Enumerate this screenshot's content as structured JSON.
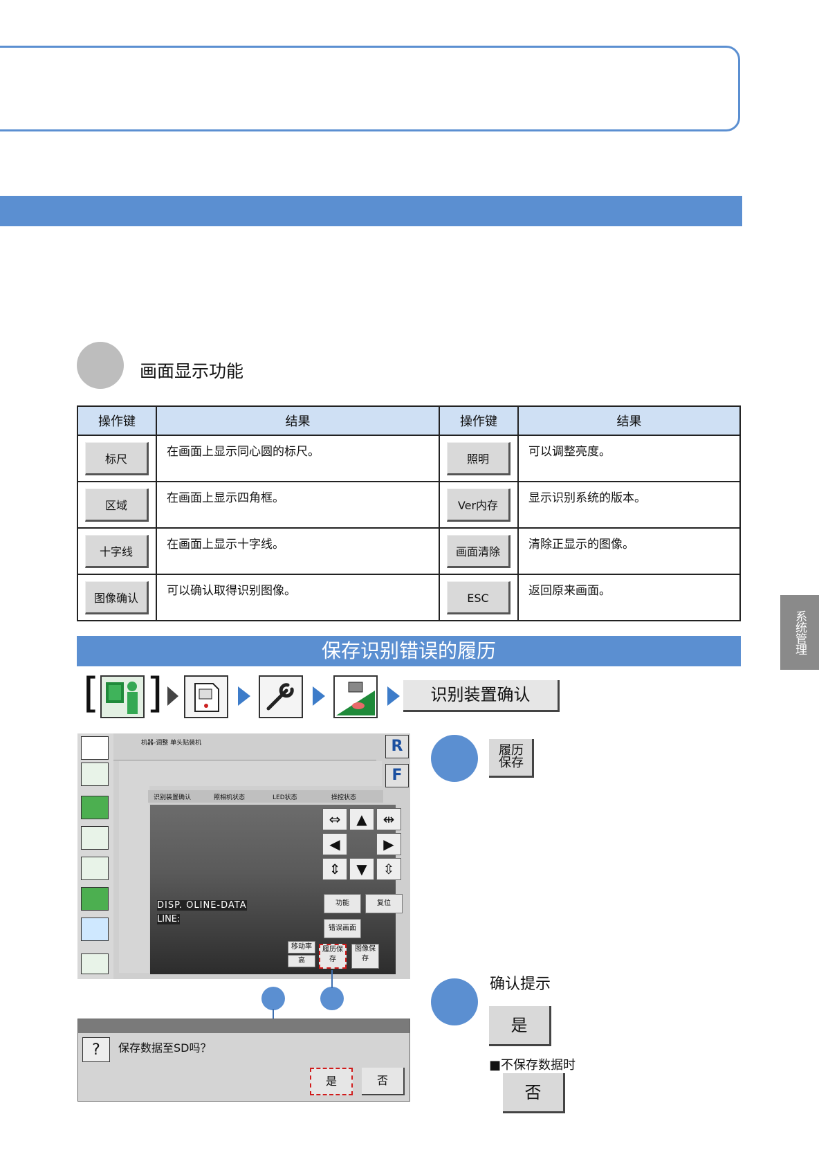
{
  "section": {
    "title": "画面显示功能"
  },
  "table": {
    "headers": [
      "操作键",
      "结果",
      "操作键",
      "结果"
    ],
    "rows": [
      {
        "key1": "标尺",
        "res1": "在画面上显示同心圆的标尺。",
        "key2": "照明",
        "res2": "可以调整亮度。"
      },
      {
        "key1": "区域",
        "res1": "在画面上显示四角框。",
        "key2": "Ver内存",
        "res2": "显示识别系统的版本。"
      },
      {
        "key1": "十字线",
        "res1": "在画面上显示十字线。",
        "key2": "画面清除",
        "res2": "清除正显示的图像。"
      },
      {
        "key1": "图像确认",
        "res1": "可以确认取得识别图像。",
        "key2": "ESC",
        "res2": "返回原来画面。"
      }
    ]
  },
  "side_tab": "系统管理",
  "save_section": {
    "title": "保存识别错误的履历",
    "nav_label": "识别装置确认",
    "history_button": "履历保存",
    "confirm_label": "确认提示",
    "yes_label": "是",
    "no_save_note": "■不保存数据时",
    "no_label": "否"
  },
  "screen": {
    "tabs": [
      "识别装置确认",
      "照相机状态",
      "LED状态",
      "操控状态"
    ],
    "overlay_text": "DISP. OLINE-DATA",
    "line_label": "LINE:",
    "buttons": [
      "功能",
      "复位",
      "错误画面",
      "移动率",
      "高",
      "履历保存",
      "图像保存"
    ],
    "r_key": "R",
    "f_key": "F",
    "machine_label": "机器-调整 单头贴装机"
  },
  "dialog": {
    "message": "保存数据至SD吗？",
    "yes": "是",
    "no": "否"
  },
  "colors": {
    "accent": "#5b8fd1",
    "marker_red": "#d01c1c"
  }
}
